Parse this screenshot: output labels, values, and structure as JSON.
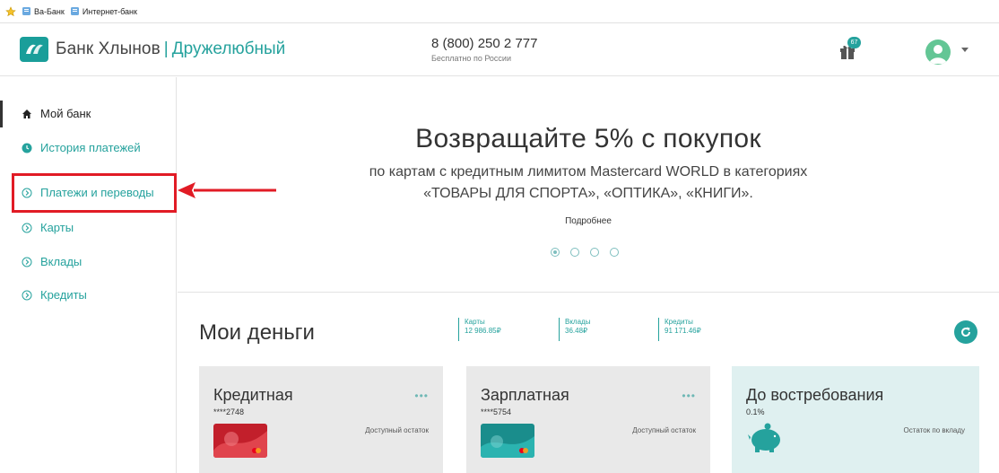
{
  "favorites": {
    "items": [
      "Ва-Банк",
      "Интернет-банк"
    ]
  },
  "header": {
    "brand": "Банк Хлынов",
    "separator": "|",
    "tagline": "Дружелюбный",
    "phone": "8 (800) 250 2 777",
    "phone_note": "Бесплатно по России",
    "gift_badge": "67"
  },
  "sidebar": {
    "items": [
      {
        "label": "Мой банк",
        "icon": "home-icon"
      },
      {
        "label": "История платежей",
        "icon": "clock-icon"
      },
      {
        "label": "Платежи и переводы",
        "icon": "chevron-circle-icon"
      },
      {
        "label": "Карты",
        "icon": "chevron-circle-icon"
      },
      {
        "label": "Вклады",
        "icon": "chevron-circle-icon"
      },
      {
        "label": "Кредиты",
        "icon": "chevron-circle-icon"
      }
    ]
  },
  "banner": {
    "title": "Возвращайте 5% с покупок",
    "line1": "по картам с кредитным лимитом Mastercard WORLD в категориях",
    "line2": "«ТОВАРЫ ДЛЯ СПОРТА», «ОПТИКА», «КНИГИ».",
    "more": "Подробнее",
    "slides_total": 4,
    "slide_active": 1
  },
  "money": {
    "title": "Мои деньги",
    "summary": [
      {
        "label": "Карты",
        "value": "12 986.85₽"
      },
      {
        "label": "Вклады",
        "value": "36.48₽"
      },
      {
        "label": "Кредиты",
        "value": "91 171.46₽"
      }
    ],
    "cards": [
      {
        "title": "Кредитная",
        "number": "****2748",
        "dots": "•••",
        "avail": "Доступный остаток"
      },
      {
        "title": "Зарплатная",
        "number": "****5754",
        "dots": "•••",
        "avail": "Доступный остаток"
      },
      {
        "title": "До востребования",
        "number": "0.1%",
        "avail": "Остаток по вкладу"
      }
    ]
  },
  "colors": {
    "accent": "#25a29d",
    "highlight": "#e11b25"
  }
}
